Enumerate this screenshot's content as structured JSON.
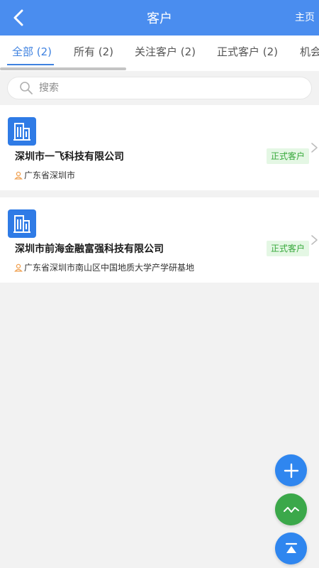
{
  "header": {
    "title": "客户",
    "home_label": "主页"
  },
  "tabs": [
    {
      "label": "全部 (2)",
      "active": true
    },
    {
      "label": "所有 (2)",
      "active": false
    },
    {
      "label": "关注客户 (2)",
      "active": false
    },
    {
      "label": "正式客户 (2)",
      "active": false
    },
    {
      "label": "机会",
      "active": false
    }
  ],
  "search": {
    "placeholder": "搜索",
    "value": ""
  },
  "customers": [
    {
      "name": "深圳市一飞科技有限公司",
      "status": "正式客户",
      "address": "广东省深圳市"
    },
    {
      "name": "深圳市前海金融富强科技有限公司",
      "status": "正式客户",
      "address": "广东省深圳市南山区中国地质大学产学研基地"
    }
  ],
  "fab": {
    "add_icon": "plus-icon",
    "trend_icon": "trend-icon",
    "top_icon": "back-to-top-icon"
  },
  "colors": {
    "header": "#4a8def",
    "accent": "#3f82e0",
    "company_icon": "#2f7be6",
    "status_bg": "#e4f7e4",
    "status_text": "#36a83a",
    "fab_blue": "#2f86ef",
    "fab_green": "#3ba84a",
    "address_icon": "#f0a050"
  }
}
